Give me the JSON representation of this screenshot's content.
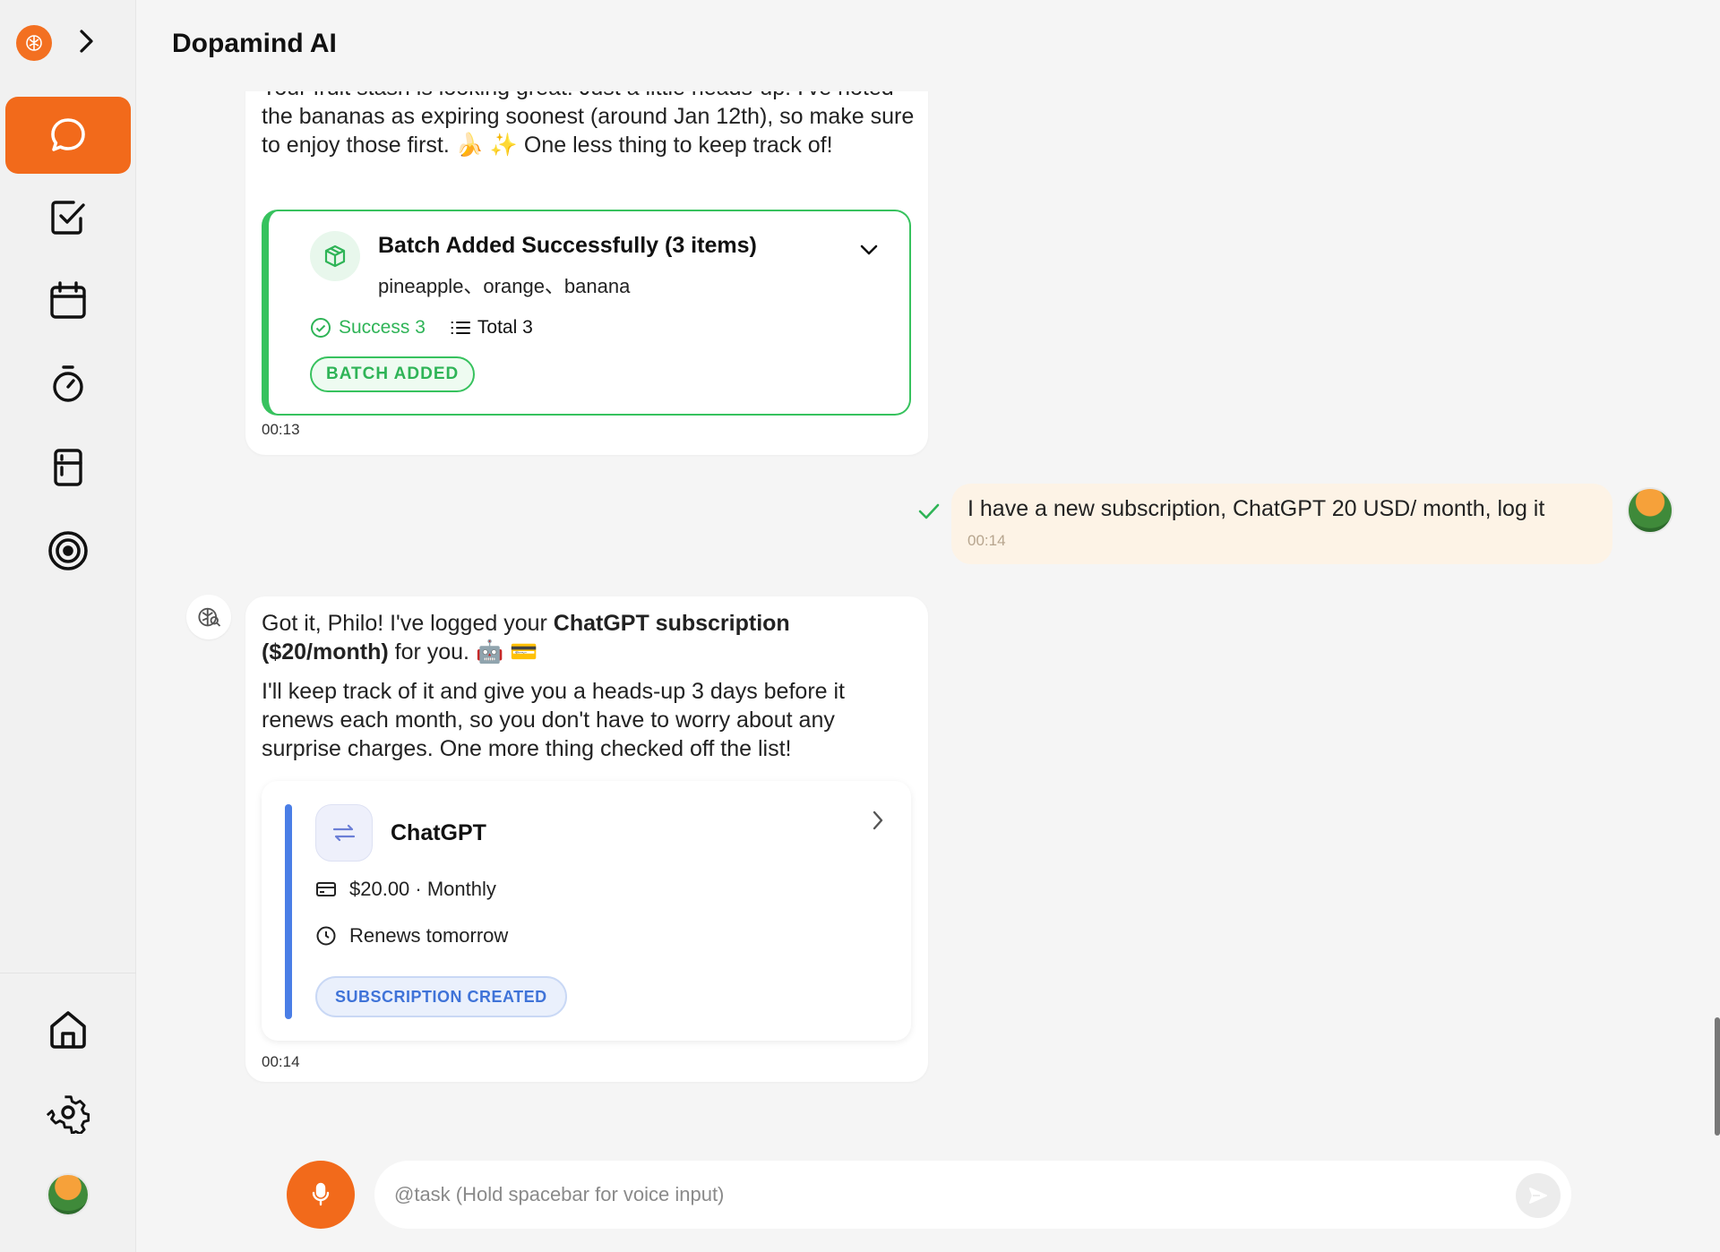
{
  "header": {
    "title": "Dopamind AI"
  },
  "messages": {
    "ai1": {
      "text_partial": "Your fruit stash is looking great! Just a little heads-up: I've noted the bananas as expiring soonest (around Jan 12th), so make sure to enjoy those first. 🍌 ✨ One less thing to keep track of!",
      "time": "00:13",
      "batch": {
        "title": "Batch Added Successfully (3 items)",
        "items": "pineapple、orange、banana",
        "success_label": "Success 3",
        "total_label": "Total 3",
        "badge": "BATCH ADDED"
      }
    },
    "user1": {
      "text": "I have a new subscription, ChatGPT 20 USD/ month, log it",
      "time": "00:14"
    },
    "ai2": {
      "p1_a": "Got it, Philo! I've logged your ",
      "p1_bold": "ChatGPT subscription ($20/month)",
      "p1_b": " for you. 🤖 💳",
      "p2": "I'll keep track of it and give you a heads-up 3 days before it renews each month, so you don't have to worry about any surprise charges. One more thing checked off the list!",
      "time": "00:14",
      "subscription": {
        "name": "ChatGPT",
        "price": "$20.00 · Monthly",
        "renew": "Renews tomorrow",
        "badge": "SUBSCRIPTION CREATED"
      }
    }
  },
  "composer": {
    "placeholder": "@task (Hold spacebar for voice input)"
  },
  "colors": {
    "accent": "#f26a1b",
    "success": "#37c25e",
    "info": "#4a7ee6",
    "user_bubble": "#fdf3e6"
  },
  "icons": [
    "brain-logo-icon",
    "chevron-right-icon",
    "chat-icon",
    "checkbox-icon",
    "calendar-icon",
    "timer-icon",
    "fridge-icon",
    "target-icon",
    "home-icon",
    "gear-icon",
    "mic-icon",
    "send-icon"
  ]
}
